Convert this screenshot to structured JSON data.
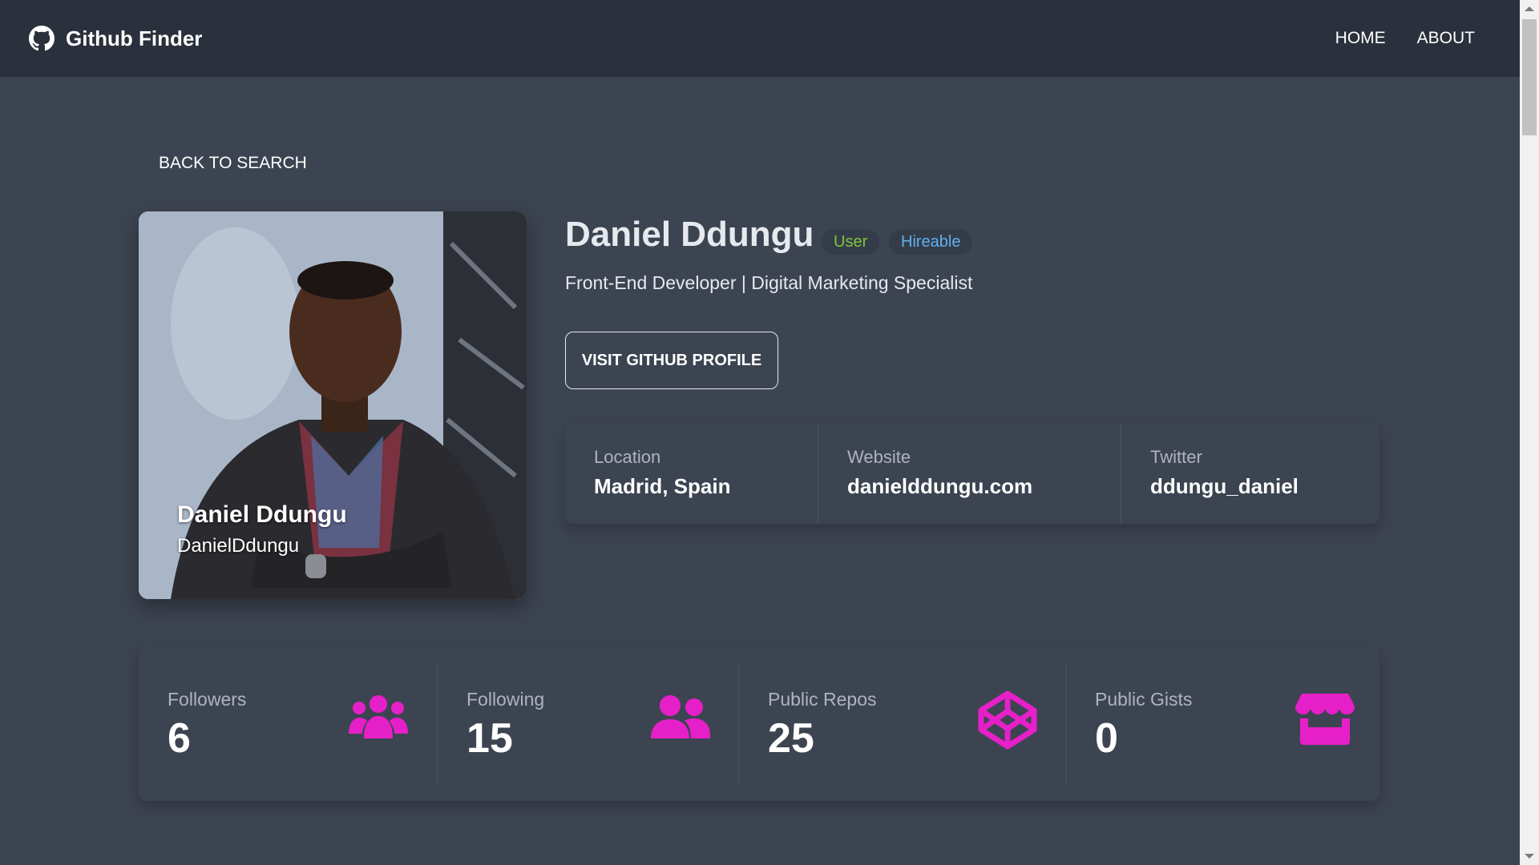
{
  "navbar": {
    "brand": "Github Finder",
    "brand_icon": "github-icon",
    "links": [
      "HOME",
      "ABOUT"
    ]
  },
  "back_link": "BACK TO SEARCH",
  "profile": {
    "photo_label": "profile-photo",
    "card_name": "Daniel Ddungu",
    "card_login": "DanielDdungu",
    "name": "Daniel Ddungu",
    "badges": {
      "type": "User",
      "hireable": "Hireable"
    },
    "bio": "Front-End Developer | Digital Marketing Specialist",
    "visit_button": "VISIT GITHUB PROFILE"
  },
  "details": [
    {
      "label": "Location",
      "value": "Madrid, Spain"
    },
    {
      "label": "Website",
      "value": "danielddungu.com"
    },
    {
      "label": "Twitter",
      "value": "ddungu_daniel"
    }
  ],
  "stats": [
    {
      "label": "Followers",
      "value": "6",
      "icon": "users-icon"
    },
    {
      "label": "Following",
      "value": "15",
      "icon": "user-friends-icon"
    },
    {
      "label": "Public Repos",
      "value": "25",
      "icon": "codepen-icon"
    },
    {
      "label": "Public Gists",
      "value": "0",
      "icon": "store-icon"
    }
  ],
  "colors": {
    "navbar_bg": "#2a303c",
    "page_bg": "#3d4451",
    "accent_icon": "#e620c8",
    "badge_user_text": "#7ec73e",
    "badge_hireable_text": "#5fb0ee"
  }
}
